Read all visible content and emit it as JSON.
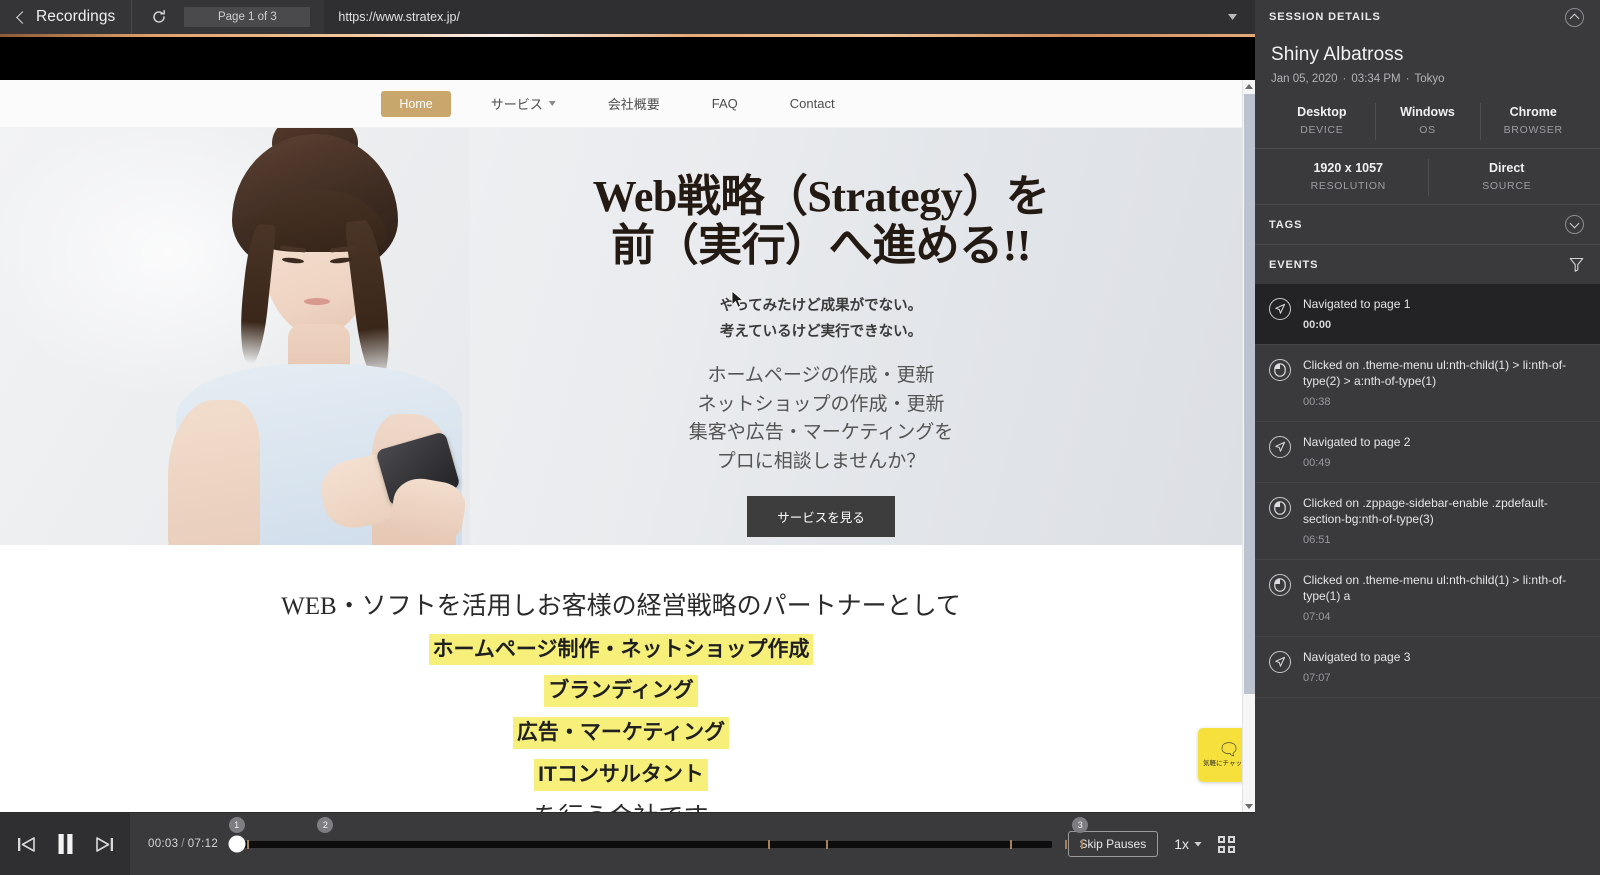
{
  "browser_bar": {
    "back_label": "Recordings",
    "back_icon": "chevron-left-icon",
    "reload_icon": "reload-icon",
    "page_indicator": "Page 1 of 3",
    "url": "https://www.stratex.jp/",
    "url_caret_icon": "chevron-down-icon"
  },
  "site": {
    "nav": [
      {
        "label": "Home",
        "active": true,
        "caret": false
      },
      {
        "label": "サービス",
        "active": false,
        "caret": true
      },
      {
        "label": "会社概要",
        "active": false,
        "caret": false
      },
      {
        "label": "FAQ",
        "active": false,
        "caret": false
      },
      {
        "label": "Contact",
        "active": false,
        "caret": false
      }
    ],
    "hero": {
      "headline_line1": "Web戦略（Strategy）を",
      "headline_line2": "前（実行）へ進める!!",
      "sub_line1": "やってみたけど成果がでない。",
      "sub_line2": "考えているけど実行できない。",
      "list_line1": "ホームページの作成・更新",
      "list_line2": "ネットショップの作成・更新",
      "list_line3": "集客や広告・マーケティングを",
      "list_line4": "プロに相談しませんか？",
      "cta_label": "サービスを見る"
    },
    "section2": {
      "line1": "WEB・ソフトを活用しお客様の経営戦略のパートナーとして",
      "hl1": "ホームページ制作・ネットショップ作成",
      "hl2": "ブランディング",
      "hl3": "広告・マーケティング",
      "hl4": "ITコンサルタント",
      "line_last": "を行う会社です"
    },
    "chat_widget": {
      "icon": "chat-bubbles-icon",
      "text": "気軽にチャットで"
    }
  },
  "controls": {
    "prev_icon": "skip-previous-icon",
    "pause_icon": "pause-icon",
    "next_icon": "skip-next-icon",
    "current_time": "00:03",
    "separator": "/",
    "total_time": "07:12",
    "progress_percent": 0.8,
    "markers": [
      {
        "label": "1",
        "position_percent": 0.8
      },
      {
        "label": "2",
        "position_percent": 11.6
      },
      {
        "label": "3",
        "position_percent": 103.5
      }
    ],
    "ticks_percent": [
      0.3,
      1.2,
      2.1,
      65.5,
      72.5,
      95.0,
      101.6,
      103.6
    ],
    "skip_pauses_label": "Skip Pauses",
    "speed_label": "1x",
    "speed_caret_icon": "chevron-down-icon",
    "fullscreen_icon": "fullscreen-icon"
  },
  "details": {
    "header_title": "SESSION DETAILS",
    "collapse_icon": "chevron-up-circle-icon",
    "session_name": "Shiny Albatross",
    "session_date": "Jan 05, 2020",
    "session_time": "03:34 PM",
    "session_location": "Tokyo",
    "stats_row1": [
      {
        "value": "Desktop",
        "label": "DEVICE"
      },
      {
        "value": "Windows",
        "label": "OS"
      },
      {
        "value": "Chrome",
        "label": "BROWSER"
      }
    ],
    "stats_row2": [
      {
        "value": "1920 x 1057",
        "label": "RESOLUTION"
      },
      {
        "value": "Direct",
        "label": "SOURCE"
      }
    ],
    "tags": {
      "title": "TAGS",
      "expand_icon": "chevron-down-circle-icon"
    },
    "events": {
      "title": "EVENTS",
      "filter_icon": "filter-icon",
      "items": [
        {
          "icon": "navigate-icon",
          "label": "Navigated to page 1",
          "time": "00:00",
          "active": true
        },
        {
          "icon": "mouse-click-icon",
          "label": "Clicked on .theme-menu ul:nth-child(1) > li:nth-of-type(2) > a:nth-of-type(1)",
          "time": "00:38",
          "active": false
        },
        {
          "icon": "navigate-icon",
          "label": "Navigated to page 2",
          "time": "00:49",
          "active": false
        },
        {
          "icon": "mouse-click-icon",
          "label": "Clicked on .zppage-sidebar-enable .zpdefault-section-bg:nth-of-type(3)",
          "time": "06:51",
          "active": false
        },
        {
          "icon": "mouse-click-icon",
          "label": "Clicked on .theme-menu ul:nth-child(1) > li:nth-of-type(1) a",
          "time": "07:04",
          "active": false
        },
        {
          "icon": "navigate-icon",
          "label": "Navigated to page 3",
          "time": "07:07",
          "active": false
        }
      ]
    }
  },
  "colors": {
    "accent_orange": "#e0a06a",
    "nav_active": "#c9a66b",
    "highlight_yellow": "#f6ef7a",
    "chat_yellow": "#f5e03c",
    "panel_bg": "#3a3a3d",
    "active_event_bg": "#232326"
  }
}
